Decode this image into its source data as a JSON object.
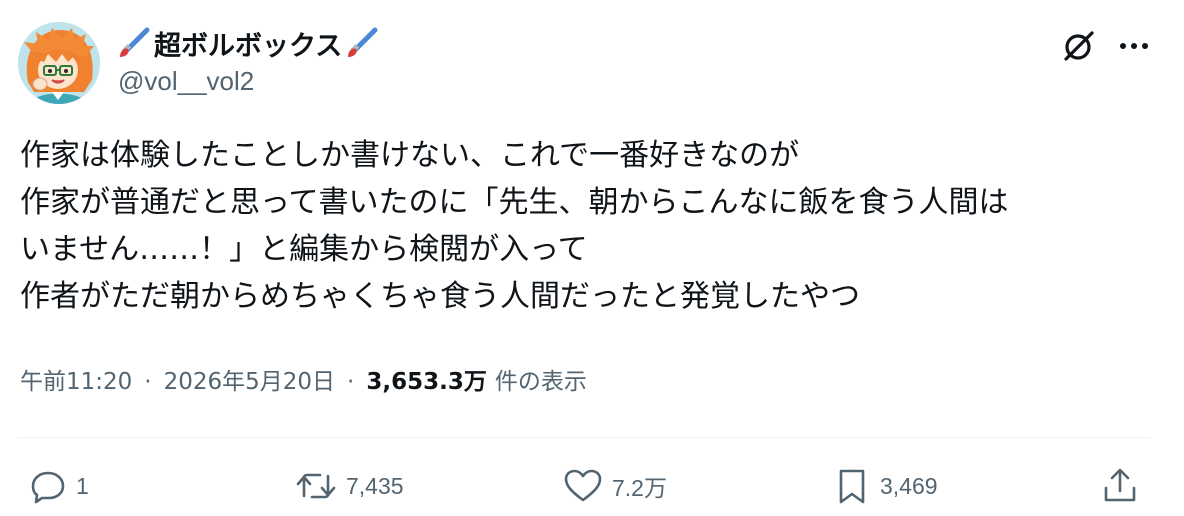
{
  "user": {
    "display_name": "超ボルボックス",
    "handle": "@vol__vol2",
    "name_decoration_icon": "paintbrush-icon"
  },
  "tweet": {
    "lines": [
      "作家は体験したことしか書けない、これで一番好きなのが",
      "作家が普通だと思って書いたのに「先生、朝からこんなに飯を食う人間は",
      "いません……！」と編集から検閲が入って",
      "作者がただ朝からめちゃくちゃ食う人間だったと発覚したやつ"
    ]
  },
  "meta": {
    "time": "午前11:20",
    "separator": "·",
    "date": "2026年5月20日",
    "views_count": "3,653.3万",
    "views_label": "件の表示"
  },
  "actions": {
    "reply": {
      "icon": "reply-icon",
      "count": "1"
    },
    "retweet": {
      "icon": "retweet-icon",
      "count": "7,435"
    },
    "like": {
      "icon": "heart-icon",
      "count": "7.2万"
    },
    "bookmark": {
      "icon": "bookmark-icon",
      "count": "3,469"
    },
    "share": {
      "icon": "share-icon"
    }
  },
  "header_icons": {
    "grok": "grok-icon",
    "more": "more-icon"
  },
  "colors": {
    "text_primary": "#0f1419",
    "text_secondary": "#536471",
    "divider": "#eff3f4",
    "avatar_bg": "#bfe3ea",
    "avatar_hair": "#f0812e"
  }
}
